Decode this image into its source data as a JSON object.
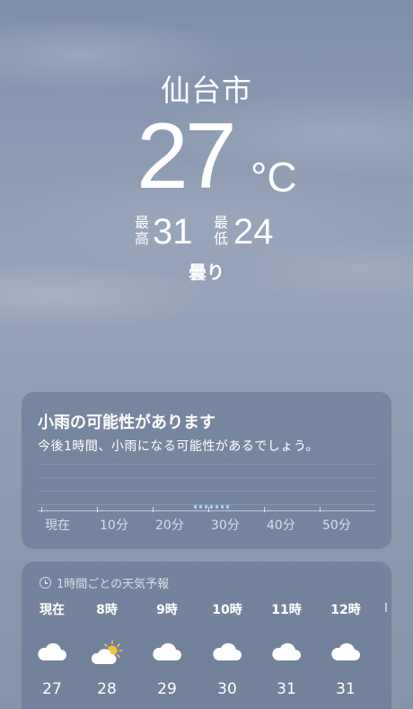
{
  "location": {
    "city": "仙台市"
  },
  "current": {
    "temperature": "27",
    "unit": "°C",
    "high_label_top": "最",
    "high_label_bottom": "高",
    "high": "31",
    "low_label_top": "最",
    "low_label_bottom": "低",
    "low": "24",
    "condition": "曇り"
  },
  "precipitation": {
    "title": "小雨の可能性があります",
    "description": "今後1時間、小雨になる可能性があるでしょう。",
    "axis_labels": [
      "現在",
      "10分",
      "20分",
      "30分",
      "40分",
      "50分"
    ],
    "rain_color": "#9cd3ff"
  },
  "hourly": {
    "header": "1時間ごとの天気予報",
    "header_icon": "clock-icon",
    "items": [
      {
        "time": "現在",
        "icon": "cloud-icon",
        "temp": "27"
      },
      {
        "time": "8時",
        "icon": "sun-behind-cloud-icon",
        "temp": "28"
      },
      {
        "time": "9時",
        "icon": "cloud-icon",
        "temp": "29"
      },
      {
        "time": "10時",
        "icon": "cloud-icon",
        "temp": "30"
      },
      {
        "time": "11時",
        "icon": "cloud-icon",
        "temp": "31"
      },
      {
        "time": "12時",
        "icon": "cloud-icon",
        "temp": "31"
      }
    ]
  },
  "colors": {
    "sun": "#f5c542",
    "card_background": "rgba(86,104,136,0.42)"
  }
}
